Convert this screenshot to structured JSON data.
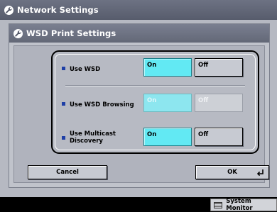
{
  "window": {
    "title": "Network Settings"
  },
  "dialog": {
    "title": "WSD Print Settings",
    "rows": [
      {
        "label": "Use WSD",
        "on_label": "On",
        "off_label": "Off",
        "selected": "On",
        "enabled": true
      },
      {
        "label": "Use WSD Browsing",
        "on_label": "On",
        "off_label": "Off",
        "selected": "On",
        "enabled": false
      },
      {
        "label": "Use Multicast Discovery",
        "on_label": "On",
        "off_label": "Off",
        "selected": "On",
        "enabled": true
      }
    ],
    "cancel_label": "Cancel",
    "ok_label": "OK"
  },
  "status_bar": {
    "system_monitor_label": "System Monitor"
  },
  "colors": {
    "selected": "#62e9f3",
    "bullet": "#1f3fa6",
    "title_bar": "#5f6474"
  }
}
